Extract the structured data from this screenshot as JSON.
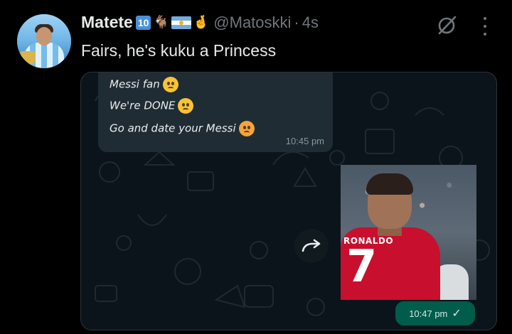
{
  "post": {
    "author_name": "Matete",
    "badge_number": "10",
    "handle": "@Matoskki",
    "separator": "·",
    "time": "4s",
    "text": "Fairs, he's kuku a Princess"
  },
  "icons": {
    "grok": "grok-icon",
    "more": "more-options-icon",
    "forward": "forward-icon",
    "check": "check-icon"
  },
  "chat": {
    "incoming": {
      "lines": [
        "Messi fan",
        "We're DONE",
        "Go and date your Messi"
      ],
      "time": "10:45 pm"
    },
    "outgoing": {
      "jersey_name": "RONALDO",
      "jersey_number": "7",
      "time": "10:47 pm",
      "check": "✓"
    }
  },
  "colors": {
    "background": "#000000",
    "text": "#e7e9ea",
    "muted": "#71767b",
    "chat_bg": "#0b141a",
    "incoming_bubble": "#202c33",
    "outgoing_bubble": "#005c4b"
  }
}
